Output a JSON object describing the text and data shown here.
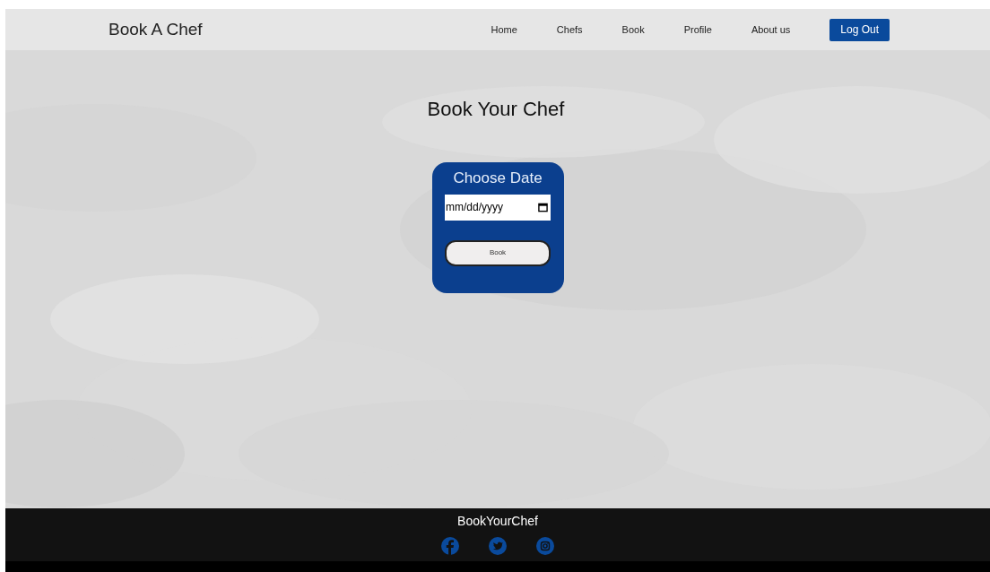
{
  "brand": "Book A Chef",
  "nav": [
    {
      "label": "Home",
      "kind": "link"
    },
    {
      "label": "Chefs",
      "kind": "link"
    },
    {
      "label": "Book",
      "kind": "link"
    },
    {
      "label": "Profile",
      "kind": "link"
    },
    {
      "label": "About us",
      "kind": "link"
    },
    {
      "label": "Log Out",
      "kind": "button"
    }
  ],
  "heading": "Book Your Chef",
  "card": {
    "title": "Choose Date",
    "date_placeholder": "mm/dd/yyyy",
    "button": "Book"
  },
  "footer": {
    "title": "BookYourChef"
  }
}
